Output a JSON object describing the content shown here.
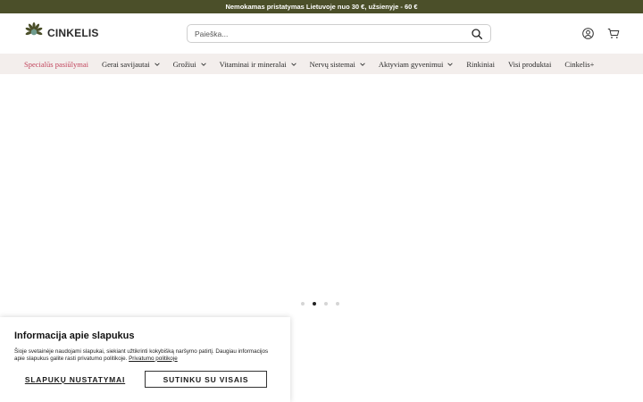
{
  "promo": {
    "text": "Nemokamas pristatymas Lietuvoje nuo 30 €, užsienyje - 60 €"
  },
  "header": {
    "logo_text": "CINKELIS",
    "search": {
      "placeholder": "Paieška...",
      "value": ""
    },
    "icons": [
      "search-icon",
      "account-icon",
      "cart-icon"
    ]
  },
  "nav": {
    "items": [
      {
        "label": "Specialūs pasiūlymai",
        "has_dropdown": false,
        "accent": "#c2455d"
      },
      {
        "label": "Gerai savijautai",
        "has_dropdown": true
      },
      {
        "label": "Grožiui",
        "has_dropdown": true
      },
      {
        "label": "Vitaminai ir mineralai",
        "has_dropdown": true
      },
      {
        "label": "Nervų sistemai",
        "has_dropdown": true
      },
      {
        "label": "Aktyviam gyvenimui",
        "has_dropdown": true
      },
      {
        "label": "Rinkiniai",
        "has_dropdown": false
      },
      {
        "label": "Visi produktai",
        "has_dropdown": false
      },
      {
        "label": "Cinkelis+",
        "has_dropdown": false
      }
    ]
  },
  "carousel": {
    "slide_count": 4,
    "active_index": 1
  },
  "cookie": {
    "title": "Informacija apie slapukus",
    "text": "Šioje svetainėje naudojami slapukai, siekiant užtikrinti kokybišką naršymo patirtį. Daugiau informacijos apie slapukus galite rasti privatumo politikoje.",
    "link_text": "Privatumo politikoje",
    "settings_label": "SLAPUKŲ NUSTATYMAI",
    "accept_label": "SUTINKU SU VISAIS"
  },
  "colors": {
    "promo_bg": "#4b4f29",
    "nav_bg": "#f3eeec",
    "special_accent": "#c2455d"
  }
}
